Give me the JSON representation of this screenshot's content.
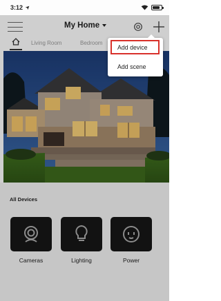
{
  "status_bar": {
    "time": "3:12",
    "battery_level": 0.85
  },
  "nav": {
    "title": "My Home"
  },
  "tabs": [
    {
      "label": ""
    },
    {
      "label": "Living Room"
    },
    {
      "label": "Bedroom"
    }
  ],
  "devices": {
    "section_title": "All Devices",
    "items": [
      {
        "label": "Cameras",
        "icon": "camera-icon"
      },
      {
        "label": "Lighting",
        "icon": "lightbulb-icon"
      },
      {
        "label": "Power",
        "icon": "outlet-icon"
      }
    ]
  },
  "dropdown": {
    "items": [
      {
        "label": "Add device",
        "highlighted": true
      },
      {
        "label": "Add scene",
        "highlighted": false
      }
    ]
  },
  "colors": {
    "highlight_border": "#d8302a",
    "tile_background": "#161616",
    "section_background": "#f2f2f2"
  }
}
